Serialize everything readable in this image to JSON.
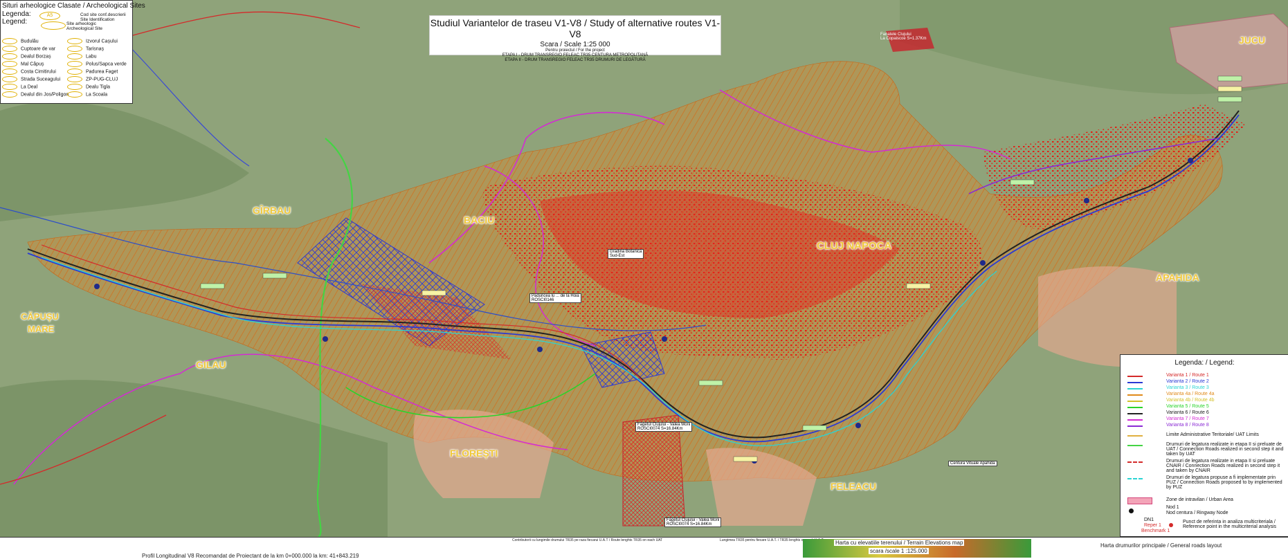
{
  "archaeology_legend": {
    "title": "Situri arheologice  Clasate / Archeological Sites",
    "legenda": "Legenda:",
    "legend": "Legend:",
    "badge": "A5",
    "key_code": "Cod site conf.descrierii Site Identification",
    "key_site": "Site arheologic Archeological Site",
    "sites_left": [
      "Budulău",
      "Cuptoare de var",
      "Dealul Borzaș",
      "Mal Căpuș",
      "Costa Cimitirului",
      "Strada Suceagului",
      "La Deal",
      "Dealul din Jos/Poligon"
    ],
    "sites_right": [
      "Izvorul Cașului",
      "Tarisnaș",
      "Labu",
      "Polus/Sapca verde",
      "Padurea Faget",
      "ZP-PUG-CLUJ",
      "Dealu Tigla",
      "La Scoala"
    ]
  },
  "title_box": {
    "title": "Studiul Variantelor de traseu V1-V8 / Study of alternative routes V1-V8",
    "scale": "Scara / Scale   1:25 000",
    "for_project": "Pentru proiectul / For the project",
    "stage1": "ETAPA I - DRUM TRANSREGIO FELEAC TR35 CENTURA METROPOLITANĂ",
    "stage2": "ETAPA II - DRUM TRANSREGIO FELEAC TR35 DRUMURI DE LEGĂTURĂ"
  },
  "places": {
    "jucu": "JUCU",
    "girbau": "GÎRBAU",
    "baciu": "BACIU",
    "cluj": "CLUJ NAPOCA",
    "apahida": "APAHIDA",
    "capusu_1": "CĂPUȘU",
    "capusu_2": "MARE",
    "gilau": "GILAU",
    "floresti": "FLOREȘTI",
    "feleacu": "FELEACU"
  },
  "annotations": {
    "fanatele_1": "Fanatele Clujului",
    "fanatele_2": "La Copaiscoe S=1.37Km",
    "rosci_1": "Fagetul Clujului - Valea Morii",
    "rosci_2": "ROSCI0074 S=16.84Km",
    "rosci_3": "Fagetul Clujului - Valea Morii",
    "rosci_4": "ROSCI0074 S=16.84Km",
    "paduricea_1": "Paduricea lu ... de la Hoia",
    "paduricea_2": "ROSCI0146",
    "gradina_1": "Gradina Botanica",
    "gradina_2": "Sud-Est",
    "centura": "Centura Vituale Apahida"
  },
  "route_legend": {
    "title": "Legenda: / Legend:",
    "routes": [
      {
        "label": "Varianta 1 / Route 1",
        "color": "#d42a2a"
      },
      {
        "label": "Varianta 2 / Route 2",
        "color": "#2a3ad4"
      },
      {
        "label": "Varianta 3 / Route 3",
        "color": "#2ad4d4"
      },
      {
        "label": "Varianta 4a / Route 4a",
        "color": "#e08a1a"
      },
      {
        "label": "Varianta 4b / Route 4b",
        "color": "#d4c02a"
      },
      {
        "label": "Varianta 5 / Route 5",
        "color": "#2ad42a"
      },
      {
        "label": "Varianta 6 / Route 6",
        "color": "#222222"
      },
      {
        "label": "Varianta 7 / Route 7",
        "color": "#d42ad4"
      },
      {
        "label": "Varianta 8 / Route 8",
        "color": "#8a2ad4"
      }
    ],
    "uat_limits": "Limite Administrative Teritoriale/ UAT Limits",
    "connection_uat": "Drumuri de legatura realizate in etapa II si preluate de UAT / Connection Roads realized in second step it and taken by UAT",
    "connection_cnair": "Drumuri de legatura realizate in etapa II si preluate CNAIR / Connection Roads realized in second step it and taken by CNAIR",
    "connection_puz": "Drumuri de legatura propuse a fi implementate prin PUZ / Connection Roads proposed to by implemented by PUZ",
    "urban_area": "Zone de  intravilan / Urban Area",
    "node_1": "Nod 1",
    "node_text": "Nod  centura / Ringway Node",
    "dn1": "DN1",
    "ref_point": "Punct de referinta in analiza multicriteriala / Reference point in the multicriterial analysis",
    "reper": "Reper 1",
    "benchmark": "Benchmark 1"
  },
  "bottom": {
    "profile": "Profil Longitudinal V8 Recomandat de Proiectant de la km 0+000.000  la km: 41+843.219",
    "contributors": "Contributorii cu lungimile drumului TR35 pe raza fiecarui U.A.T / Route lenghts TR35 on each UAT",
    "lengths": "Lungimea TR35 pentru fiecare U.A.T. / TR35 lenghts on each U.A.T.",
    "elevation_1": "Harta cu elevatiile  terenului  /  Terrain  Elevations map",
    "elevation_2": "scara /scale   1 :125.000",
    "roads_layout": "Harta drumurilor principale / General roads layout"
  },
  "colors": {
    "terrain": "#8fa37a",
    "urban_orange": "#e8801e",
    "urban_red": "#e6261f",
    "protected_blue": "#3a4ad4",
    "label_yellow": "#f0c83a",
    "main_route": "#1f2a8a"
  },
  "icons": [
    "node-icon",
    "route-swatch",
    "urban-area-swatch",
    "reference-point-icon"
  ]
}
